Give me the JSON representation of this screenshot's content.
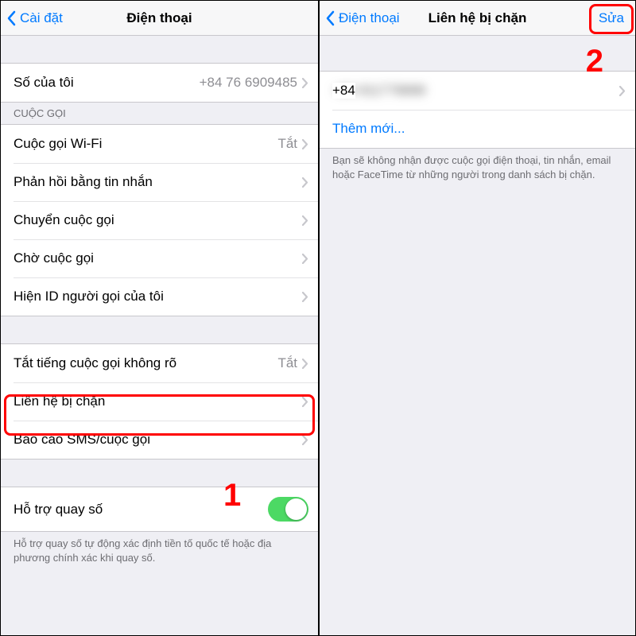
{
  "left": {
    "nav": {
      "back": "Cài đặt",
      "title": "Điện thoại"
    },
    "my_number_label": "Số của tôi",
    "my_number_value": "+84 76 6909485",
    "call_header": "CUỘC GỌI",
    "wifi_call": "Cuộc gọi Wi-Fi",
    "wifi_call_value": "Tắt",
    "reply_msg": "Phản hồi bằng tin nhắn",
    "forwarding": "Chuyển cuộc gọi",
    "waiting": "Chờ cuộc gọi",
    "caller_id": "Hiện ID người gọi của tôi",
    "silence": "Tắt tiếng cuộc gọi không rõ",
    "silence_value": "Tắt",
    "blocked": "Liên hệ bị chặn",
    "report": "Báo cáo SMS/cuộc gọi",
    "dial_assist": "Hỗ trợ quay số",
    "dial_assist_footer": "Hỗ trợ quay số tự động xác định tiền tố quốc tế hoặc địa phương chính xác khi quay số.",
    "step": "1"
  },
  "right": {
    "nav": {
      "back": "Điện thoại",
      "title": "Liên hệ bị chặn",
      "edit": "Sửa"
    },
    "blocked_number": "+84 911778888",
    "add_new": "Thêm mới...",
    "footer": "Bạn sẽ không nhận được cuộc gọi điện thoại, tin nhắn, email hoặc FaceTime từ những người trong danh sách bị chặn.",
    "step": "2"
  }
}
